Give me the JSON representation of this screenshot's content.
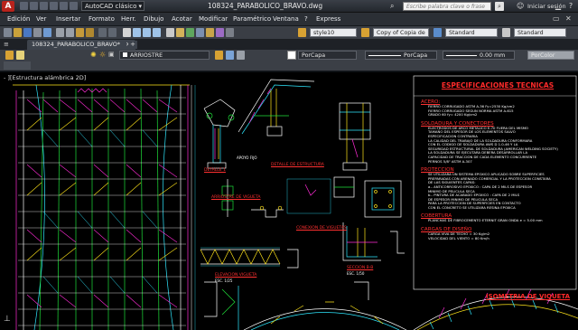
{
  "app": {
    "logo_letter": "A",
    "workspace": "AutoCAD clásico",
    "file_title": "108324_PARABOLICO_BRAVO.dwg",
    "search_placeholder": "Escribe palabra clave o frase",
    "signin": "Iniciar sesión"
  },
  "menu": [
    "Edición",
    "Ver",
    "Insertar",
    "Formato",
    "Herr.",
    "Dibujo",
    "Acotar",
    "Modificar",
    "Paramétrico",
    "Ventana",
    "?",
    "Express"
  ],
  "toolbar": {
    "text_style": "style10",
    "dim_style": "Copy of Copia de",
    "table_style": "Standard",
    "multileader_style": "Standard",
    "layer": "ARRIOSTRE",
    "color": "PorCapa",
    "linetype": "PorCapa",
    "lineweight": "0.00 mm",
    "plotstyle": "PorColor"
  },
  "doc_tab": "108324_PARABOLICO_BRAVO*",
  "viewport_label": "- ][Estructura alámbrica 2D]",
  "colors": {
    "accent_red": "#ff2a2a",
    "cad_green": "#1fe03a",
    "cad_magenta": "#ff2bd6",
    "cad_yellow": "#ffe41a",
    "cad_cyan": "#2fe8ff"
  },
  "spec_sheet": {
    "title": "ESPECIFICACIONES TECNICAS",
    "sections": [
      {
        "head": "ACERO:",
        "lines": [
          "FIERRO CORRUGADO ASTM A-36 Fy=2530 Kg/cm2",
          "FIERRO CORRUGADO SEGUN NORMA ASTM A-615",
          "GRADO 60 fy= 4200 Kg/cm2"
        ]
      },
      {
        "head": "SOLDADURA Y CONECTORES",
        "lines": [
          "ELECTRODOS DE ARCO METALICO E-70 FUERA DEL MISMO",
          "TAMAÑO DEL ESPESOR DE LOS ELEMENTOS SALVO",
          "ESPECIFICACION CONTRARIA",
          "LA CALIDAD DEL TRABAJO DE LA SOLDADURA CONFORMARA",
          "CON EL CODIGO DE SOLDADURA AWS D 1.0-46 Y LA",
          "SEGURIDAD ESTRUCTURAL DE SOLDADURA (AMERICAN WELDING SOCIETY)",
          "LA SOLDADURA SE EJECUTARA DEBERA DESARROLLAR LA",
          "CAPACIDAD DE TRACCION DE CADA ELEMENTO CONCURRENTE",
          "PERNOS 5/8\" ASTM A-307"
        ]
      },
      {
        "head": "PROTECCION",
        "lines": [
          "SE UTILIZARA UN SISTEMA EPOXICO APLICADO SOBRE SUPERFICIES",
          "PREPARADAS CON ARENADO COMERCIAL Y LA PROTECCION CONSTARA",
          "DE LAS SIGUIENTES CAPAS:",
          "a.- ANTICORROSIVO EPOXICO : CAPA DE 2 MILS DE ESPESOR",
          "   MINIMO DE PELICULA SECA",
          "b.- PINTURA DE ACABADO EPOXICO : CAPA DE 2 MILS",
          "   DE ESPESOR MINIMO DE PELICULA SECA",
          "PARA LA PROTECCION DE SUPERFICIES EN CONTACTO",
          "CON EL CONCRETO SE UTILIZARA RESINA EPOXICA"
        ]
      },
      {
        "head": "COBERTURA",
        "lines": [
          "PLANCHAS DE FIBROCEMENTO ETERNIT GRAN ONDA e = 5.00 mm"
        ]
      },
      {
        "head": "CARGAS DE DISEÑO",
        "lines": [
          "CARGA VIVA DE TECHO = 30 Kg/m2",
          "VELOCIDAD DEL VIENTO = 80 Km/h"
        ]
      }
    ],
    "isometric_title": "ISOMETRIA DE VIQUETA"
  },
  "drawing_labels": {
    "detail_1": "DETALLE 1",
    "apoyo": "APOYO FIJO",
    "viguetas_title": "CONEXION DE VIGUETAS",
    "elevation_title": "ELEVACION VIGUETA",
    "section_title": "SECCION B-B",
    "scale_1": "ESC. 1/25",
    "scale_2": "ESC. 1/50",
    "arriostre_title": "ARRIOSTRE DE VIGUETA",
    "cercha_title": "DETALLE DE ESTRUCTURA"
  }
}
